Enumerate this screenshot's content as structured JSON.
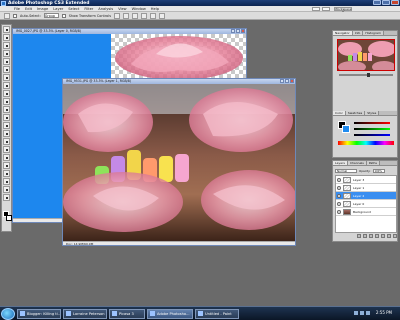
{
  "app": {
    "title": "Adobe Photoshop CS3 Extended"
  },
  "menu": [
    "File",
    "Edit",
    "Image",
    "Layer",
    "Select",
    "Filter",
    "Analysis",
    "View",
    "Window",
    "Help"
  ],
  "options_bar": {
    "auto_select": "Auto-Select:",
    "auto_select_value": "Group",
    "transform": "Show Transform Controls"
  },
  "workspace": {
    "label": "Workspace ▾"
  },
  "documents": [
    {
      "title": "IMG_0027.JPG @ 33.3% (Layer 0, RGB/8)"
    },
    {
      "title": "IMG_9531.JPG @ 33.3% (Layer 1, RGB/8)",
      "status": "Doc: 14.9M/60.9M"
    }
  ],
  "panels": {
    "navigator_tabs": [
      "Navigator",
      "Info",
      "Histogram"
    ],
    "color_tabs": [
      "Color",
      "Swatches",
      "Styles"
    ],
    "layer_tabs": [
      "Layers",
      "Channels",
      "Paths"
    ],
    "blend_mode": "Normal",
    "opacity_label": "Opacity:",
    "opacity_value": "100%",
    "fill_label": "Fill:",
    "fill_value": "100%",
    "layers": [
      {
        "name": "Layer 3",
        "selected": false,
        "background": false
      },
      {
        "name": "Layer 1",
        "selected": false,
        "background": false
      },
      {
        "name": "Layer 2",
        "selected": true,
        "background": false
      },
      {
        "name": "Layer 0",
        "selected": false,
        "background": false
      },
      {
        "name": "Background",
        "selected": false,
        "background": true
      }
    ]
  },
  "colors": {
    "accent": "#1f8bef",
    "selected_layer": "#3a8ef0"
  },
  "taskbar": {
    "items": [
      {
        "label": "Blogger: Killing ti...",
        "active": false
      },
      {
        "label": "Lorraine Peterson",
        "active": false
      },
      {
        "label": "Picasa 3",
        "active": false
      },
      {
        "label": "Adobe Photosho...",
        "active": true
      },
      {
        "label": "Untitled - Paint",
        "active": false
      }
    ],
    "clock": "2:55 PM"
  }
}
